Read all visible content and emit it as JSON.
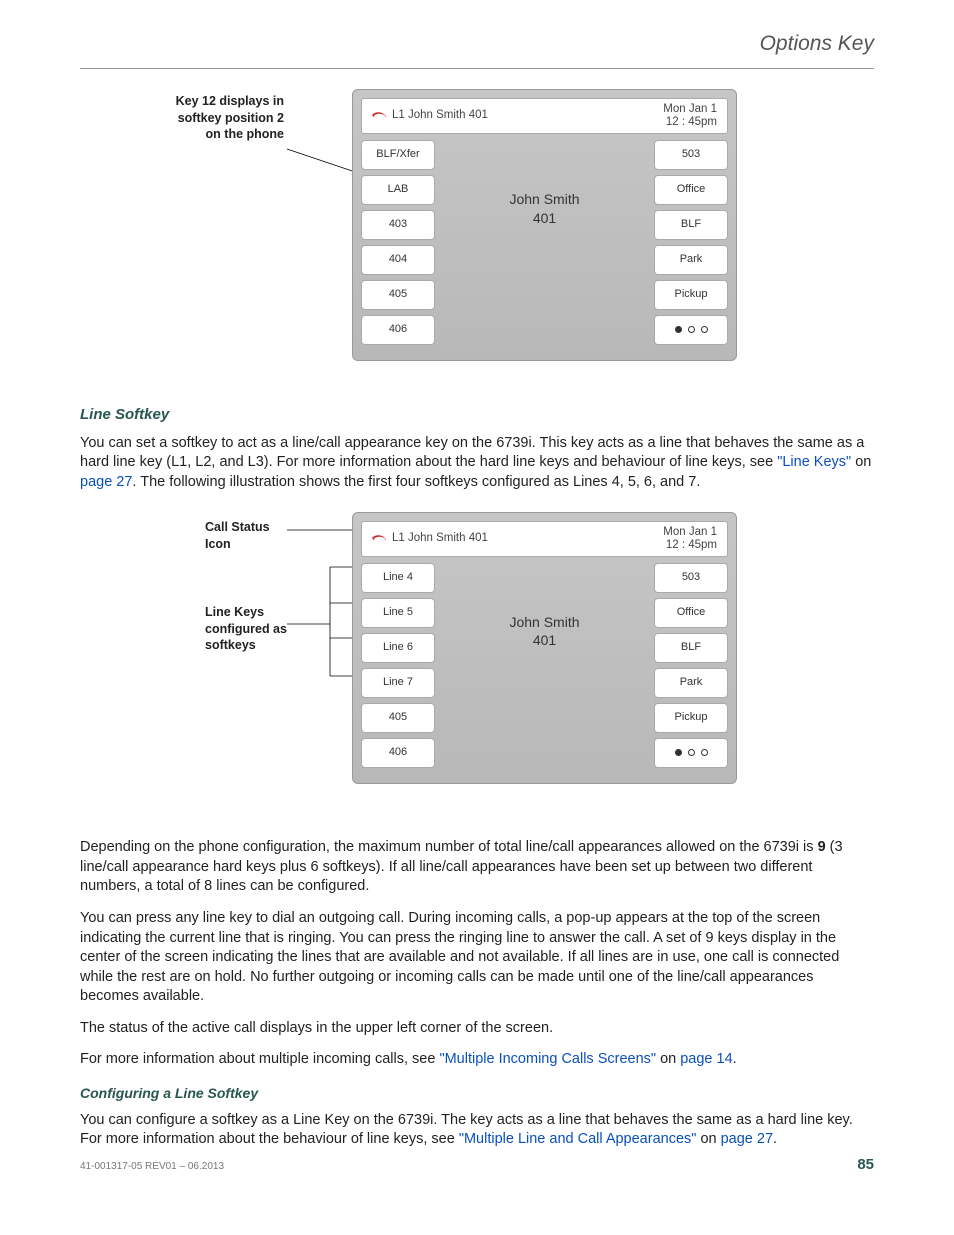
{
  "header": {
    "title": "Options Key"
  },
  "figure1": {
    "annotation": [
      "Key 12 displays in",
      "softkey position 2",
      "on the phone"
    ],
    "phone": {
      "line_label": "L1 John Smith 401",
      "date": "Mon Jan 1",
      "time": "12 : 45pm",
      "left_keys": [
        "BLF/Xfer",
        "LAB",
        "403",
        "404",
        "405",
        "406"
      ],
      "right_keys": [
        "503",
        "Office",
        "BLF",
        "Park",
        "Pickup"
      ],
      "center_name": "John Smith",
      "center_ext": "401"
    }
  },
  "section1": {
    "heading": "Line Softkey",
    "para1_pre": "You can set a softkey to act as a line/call appearance key on the 6739i. This key acts as a line that behaves the same as a hard line key (L1, L2, and L3). For more information about the hard line keys and behaviour of line keys, see ",
    "link1": "\"Line Keys\"",
    "para1_mid": " on ",
    "link2": "page 27",
    "para1_post": ". The following illustration shows the first four softkeys configured as Lines 4, 5, 6, and 7."
  },
  "figure2": {
    "annotation1": [
      "Call Status",
      "Icon"
    ],
    "annotation2": [
      "Line Keys",
      "configured as",
      "softkeys"
    ],
    "phone": {
      "line_label": "L1 John Smith 401",
      "date": "Mon Jan 1",
      "time": "12 : 45pm",
      "left_keys": [
        "Line 4",
        "Line 5",
        "Line 6",
        "Line 7",
        "405",
        "406"
      ],
      "right_keys": [
        "503",
        "Office",
        "BLF",
        "Park",
        "Pickup"
      ],
      "center_name": "John Smith",
      "center_ext": "401"
    }
  },
  "para2_pre": "Depending on the phone configuration, the maximum number of total line/call appearances allowed on the 6739i is ",
  "para2_bold": "9",
  "para2_post": " (3 line/call appearance hard keys plus 6 softkeys). If all line/call appearances have been set up between two different numbers, a total of 8 lines can be configured.",
  "para3": "You can press any line key to dial an outgoing call. During incoming calls, a pop-up appears at the top of the screen indicating the current line that is ringing. You can press the ringing line to answer the call. A set of 9 keys display in the center of the screen indicating the lines that are available and not available. If all lines are in use, one call is connected while the rest are on hold. No further outgoing or incoming calls can be made until one of the line/call appearances becomes available.",
  "para4": "The status of the active call displays in the upper left corner of the screen.",
  "para5_pre": "For more information about multiple incoming calls, see ",
  "para5_link1": "\"Multiple Incoming Calls Screens\"",
  "para5_mid": " on ",
  "para5_link2": "page 14",
  "para5_post": ".",
  "section2": {
    "heading": "Configuring a Line Softkey",
    "para_pre": "You can configure a softkey as a Line Key on the 6739i. The key acts as a line that behaves the same as a hard line key. For more information about the behaviour of line keys, see ",
    "link1": "\"Multiple Line and Call Appearances\"",
    "mid": " on ",
    "link2": "page 27",
    "post": "."
  },
  "footer": {
    "rev": "41-001317-05 REV01 – 06.2013",
    "page": "85"
  }
}
